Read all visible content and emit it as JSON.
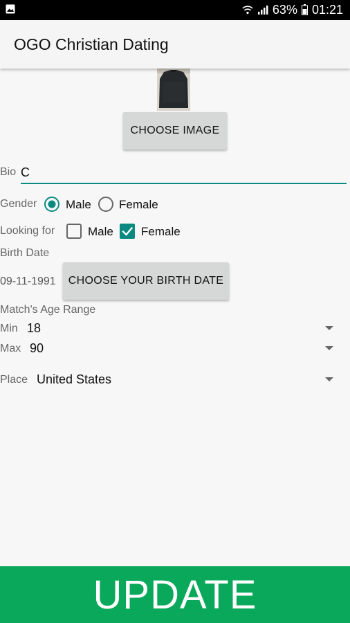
{
  "status_bar": {
    "battery": "63%",
    "time": "01:21",
    "icons": [
      "gallery-icon",
      "wifi-icon",
      "signal-icon",
      "battery-icon"
    ]
  },
  "app_bar": {
    "title": "OGO Christian Dating"
  },
  "profile": {
    "choose_image_label": "CHOOSE IMAGE",
    "bio_label": "Bio",
    "bio_value": "C",
    "gender": {
      "label": "Gender",
      "options": [
        "Male",
        "Female"
      ],
      "selected": "Male"
    },
    "looking_for": {
      "label": "Looking for",
      "options": [
        {
          "label": "Male",
          "checked": false
        },
        {
          "label": "Female",
          "checked": true
        }
      ]
    },
    "birth_date": {
      "label": "Birth Date",
      "value": "09-11-1991",
      "button_label": "CHOOSE YOUR BIRTH DATE"
    },
    "age_range": {
      "label": "Match's Age Range",
      "min_label": "Min",
      "min_value": "18",
      "max_label": "Max",
      "max_value": "90"
    },
    "place": {
      "label": "Place",
      "value": "United States"
    }
  },
  "update_label": "UPDATE",
  "colors": {
    "accent": "#0a8a80",
    "update_bg": "#0aa85a",
    "button_bg": "#d6d7d7",
    "appbar_bg": "#f5f5f5"
  }
}
